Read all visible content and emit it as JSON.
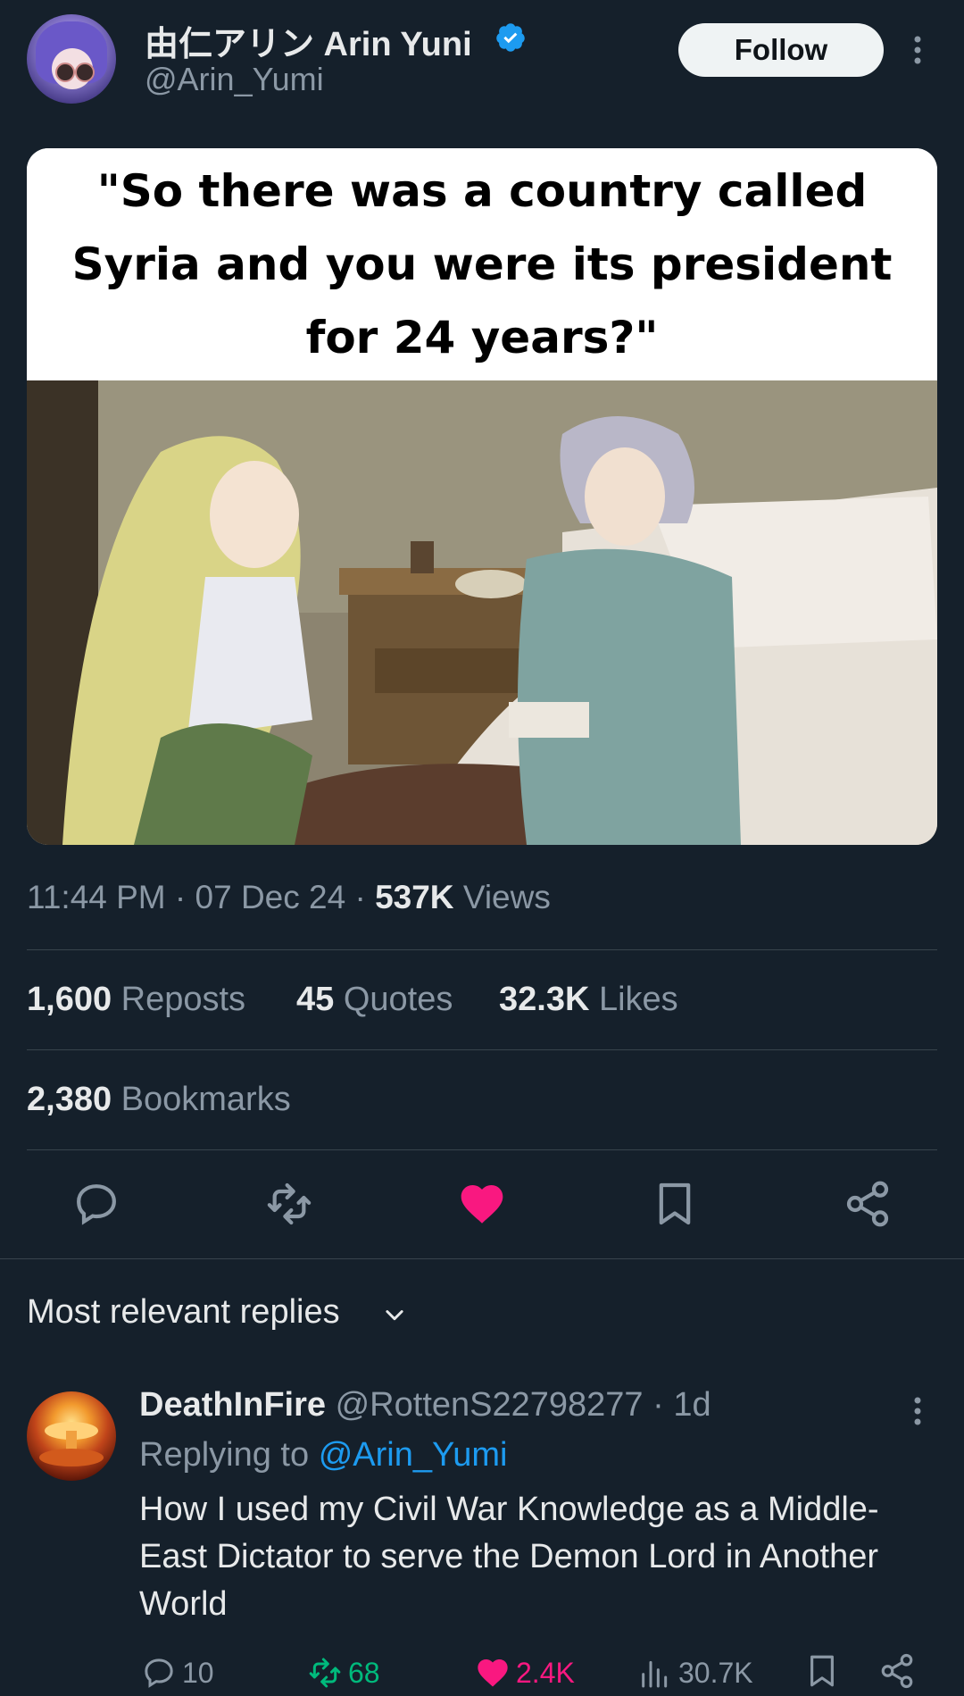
{
  "author": {
    "display_name": "由仁アリン Arin Yuni",
    "handle": "@Arin_Yumi",
    "follow_label": "Follow"
  },
  "media": {
    "caption": "\"So there was a country called Syria and you were its president for 24 years?\""
  },
  "meta": {
    "time": "11:44 PM",
    "date": "07 Dec 24",
    "views_count": "537K",
    "views_label": "Views",
    "sep": "·"
  },
  "stats": {
    "reposts_count": "1,600",
    "reposts_label": "Reposts",
    "quotes_count": "45",
    "quotes_label": "Quotes",
    "likes_count": "32.3K",
    "likes_label": "Likes",
    "bookmarks_count": "2,380",
    "bookmarks_label": "Bookmarks"
  },
  "actions": [
    "reply-icon",
    "repost-icon",
    "like-icon",
    "bookmark-icon",
    "share-icon"
  ],
  "colors": {
    "like": "#f91880",
    "repost": "#00ba7c",
    "link": "#1d9bf0",
    "verified": "#1d9bf0"
  },
  "replies": {
    "sort_label": "Most relevant replies",
    "items": [
      {
        "name": "DeathInFire",
        "handle": "@RottenS22798277",
        "age": "1d",
        "replying_prefix": "Replying to",
        "replying_to": "@Arin_Yumi",
        "text": "How I used my Civil War Knowledge as a Middle-East Dictator to serve the Demon Lord in Another World",
        "reply_count": "10",
        "repost_count": "68",
        "like_count": "2.4K",
        "view_count": "30.7K"
      }
    ]
  }
}
